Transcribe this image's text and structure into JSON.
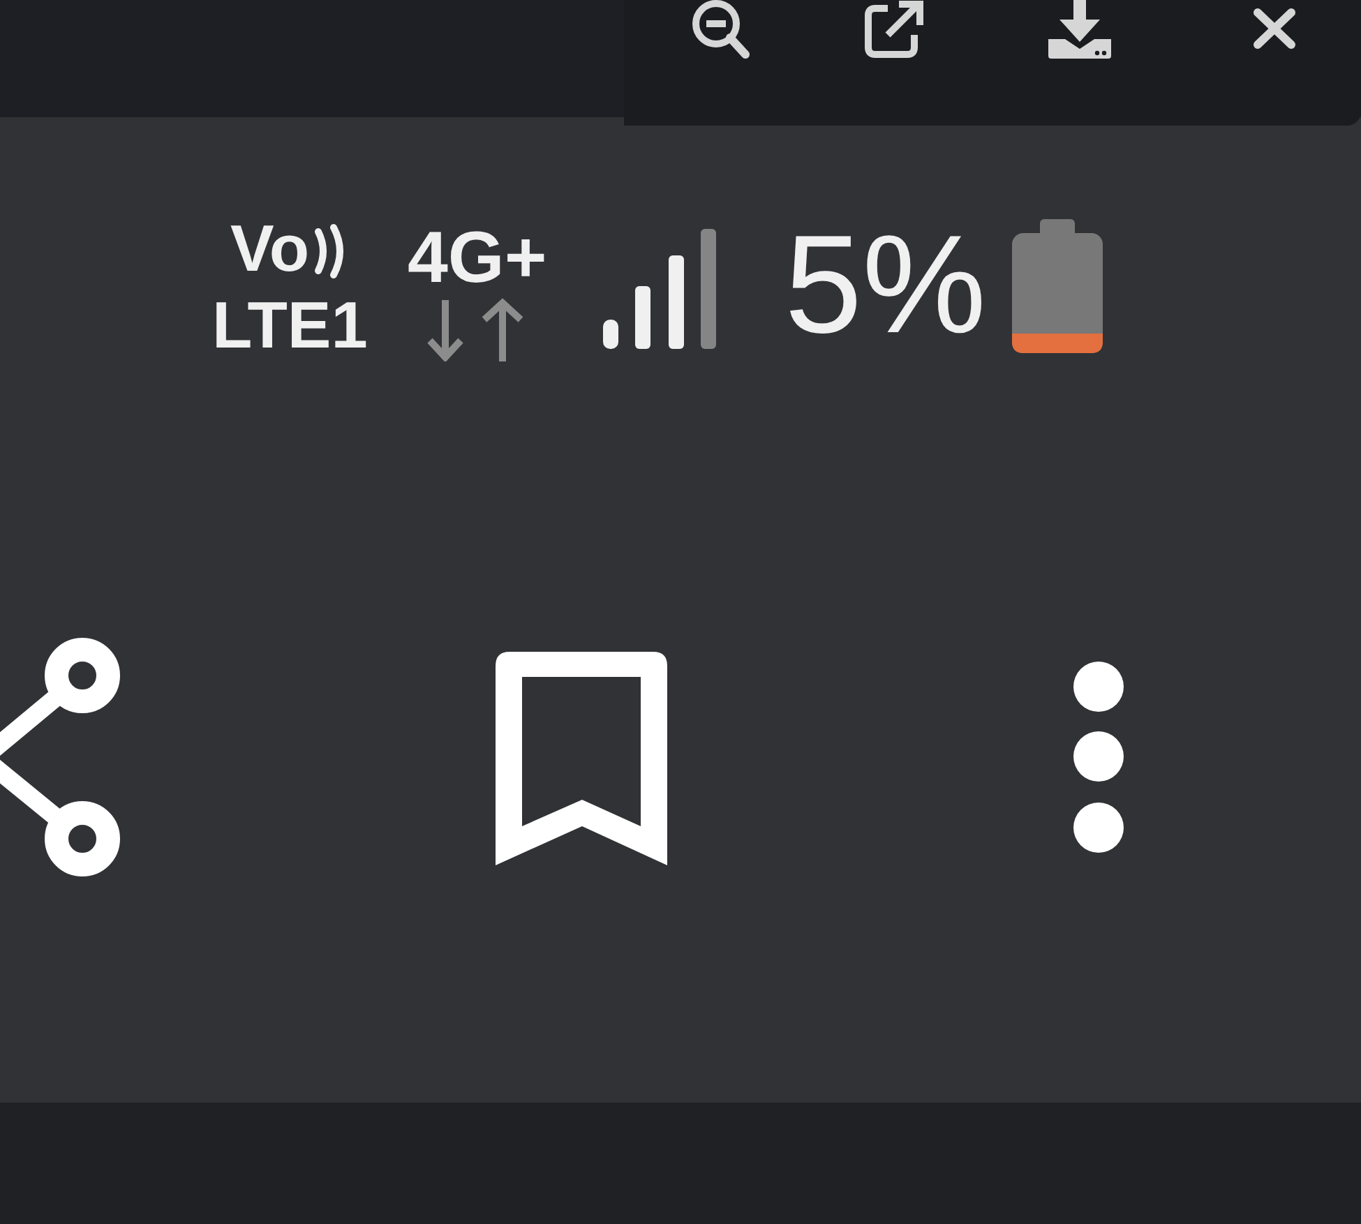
{
  "viewer_toolbar": {
    "buttons": [
      {
        "kind": "zoom_out"
      },
      {
        "kind": "open_external"
      },
      {
        "kind": "download"
      },
      {
        "kind": "close"
      }
    ]
  },
  "status_bar": {
    "volte_top": "Vo",
    "volte_bottom": "LTE1",
    "network_type": "4G+",
    "battery_percent": "5%"
  },
  "action_bar": {
    "buttons": [
      {
        "kind": "share"
      },
      {
        "kind": "bookmark"
      },
      {
        "kind": "more"
      }
    ]
  }
}
